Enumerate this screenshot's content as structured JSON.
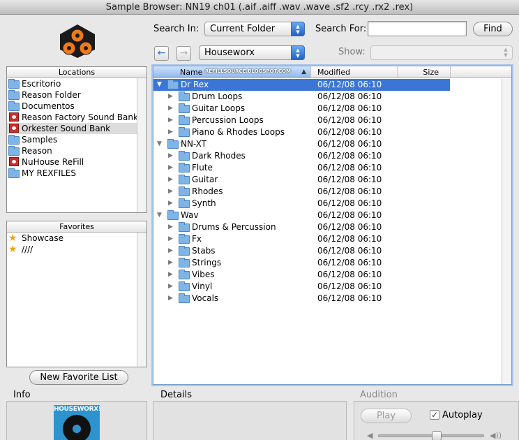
{
  "window": {
    "title": "Sample Browser: NN19 ch01 (.aif .aiff .wav .wave .sf2 .rcy .rx2 .rex)"
  },
  "toolbar": {
    "search_in_label": "Search In:",
    "search_in_value": "Current Folder",
    "search_for_label": "Search For:",
    "search_for_value": "",
    "find_label": "Find",
    "back_icon": "back-arrow-icon",
    "forward_icon": "forward-arrow-icon",
    "folder_value": "Houseworx",
    "show_label": "Show:",
    "show_value": ""
  },
  "locations": {
    "header": "Locations",
    "items": [
      {
        "label": "Escritorio",
        "icon": "folder-icon"
      },
      {
        "label": "Reason Folder",
        "icon": "folder-icon"
      },
      {
        "label": "Documentos",
        "icon": "folder-icon"
      },
      {
        "label": "Reason Factory Sound Bank",
        "icon": "refill-icon"
      },
      {
        "label": "Orkester Sound Bank",
        "icon": "refill-icon"
      },
      {
        "label": "Samples",
        "icon": "folder-icon"
      },
      {
        "label": "Reason",
        "icon": "folder-icon"
      },
      {
        "label": "NuHouse ReFill",
        "icon": "refill-icon"
      },
      {
        "label": "MY REXFILES",
        "icon": "folder-icon"
      }
    ]
  },
  "favorites": {
    "header": "Favorites",
    "items": [
      {
        "label": "Showcase",
        "icon": "star-icon"
      },
      {
        "label": "////",
        "icon": "star-icon"
      }
    ],
    "new_list_label": "New Favorite List"
  },
  "browser": {
    "columns": {
      "name": "Name",
      "modified": "Modified",
      "size": "Size"
    },
    "watermark": "REFILLSOURCE.BLOGSPOT.COM",
    "rows": [
      {
        "name": "Dr Rex",
        "date": "06/12/08 06:10",
        "level": 0,
        "expanded": true,
        "selected": true
      },
      {
        "name": "Drum Loops",
        "date": "06/12/08 06:10",
        "level": 1
      },
      {
        "name": "Guitar Loops",
        "date": "06/12/08 06:10",
        "level": 1
      },
      {
        "name": "Percussion Loops",
        "date": "06/12/08 06:10",
        "level": 1
      },
      {
        "name": "Piano & Rhodes Loops",
        "date": "06/12/08 06:10",
        "level": 1
      },
      {
        "name": "NN-XT",
        "date": "06/12/08 06:10",
        "level": 0,
        "expanded": true
      },
      {
        "name": "Dark Rhodes",
        "date": "06/12/08 06:10",
        "level": 1
      },
      {
        "name": "Flute",
        "date": "06/12/08 06:10",
        "level": 1
      },
      {
        "name": "Guitar",
        "date": "06/12/08 06:10",
        "level": 1
      },
      {
        "name": "Rhodes",
        "date": "06/12/08 06:10",
        "level": 1
      },
      {
        "name": "Synth",
        "date": "06/12/08 06:10",
        "level": 1
      },
      {
        "name": "Wav",
        "date": "06/12/08 06:10",
        "level": 0,
        "expanded": true
      },
      {
        "name": "Drums & Percussion",
        "date": "06/12/08 06:10",
        "level": 1
      },
      {
        "name": "Fx",
        "date": "06/12/08 06:10",
        "level": 1
      },
      {
        "name": "Stabs",
        "date": "06/12/08 06:10",
        "level": 1
      },
      {
        "name": "Strings",
        "date": "06/12/08 06:10",
        "level": 1
      },
      {
        "name": "Vibes",
        "date": "06/12/08 06:10",
        "level": 1
      },
      {
        "name": "Vinyl",
        "date": "06/12/08 06:10",
        "level": 1
      },
      {
        "name": "Vocals",
        "date": "06/12/08 06:10",
        "level": 1
      }
    ]
  },
  "info": {
    "title": "Info",
    "art_text": "HOUSEWORX!"
  },
  "details": {
    "title": "Details"
  },
  "audition": {
    "title": "Audition",
    "play_label": "Play",
    "autoplay_label": "Autoplay",
    "autoplay_checked": "✓",
    "volume_level": 0.55
  }
}
